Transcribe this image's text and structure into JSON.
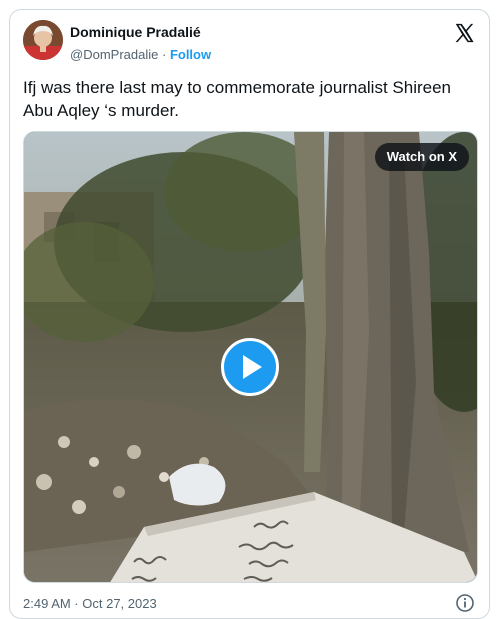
{
  "author": {
    "display_name": "Dominique Pradalié",
    "handle": "@DomPradalie",
    "separator": "·",
    "follow_label": "Follow"
  },
  "tweet": {
    "text": "Ifj was there last may to commemorate journalist Shireen Abu Aqley ‘s murder.",
    "timestamp": "2:49 AM · Oct 27, 2023"
  },
  "media": {
    "type": "video",
    "watch_label": "Watch on X",
    "play_icon": "play-icon"
  },
  "icons": {
    "brand": "x-logo-icon",
    "info": "info-icon"
  },
  "colors": {
    "accent": "#1d9bf0",
    "text": "#0f1419",
    "secondary_text": "#536471",
    "border": "#cfd9de"
  }
}
